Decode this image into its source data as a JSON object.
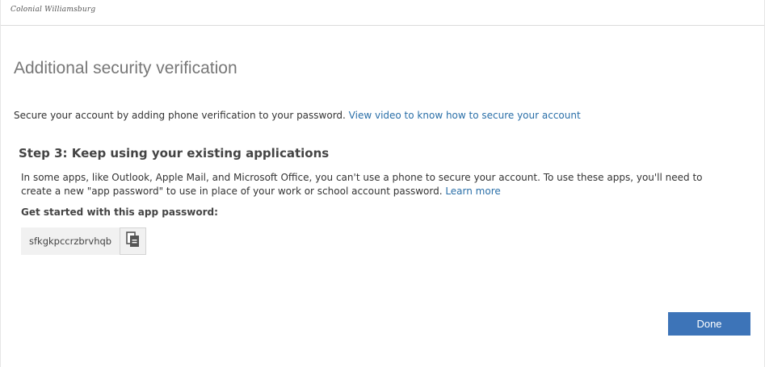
{
  "header": {
    "logo_text": "Colonial Williamsburg"
  },
  "main": {
    "title": "Additional security verification",
    "intro_text": "Secure your account by adding phone verification to your password. ",
    "intro_link": "View video to know how to secure your account",
    "step": {
      "title": "Step 3: Keep using your existing applications",
      "description": "In some apps, like Outlook, Apple Mail, and Microsoft Office, you can't use a phone to secure your account. To use these apps, you'll need to create a new \"app password\" to use in place of your work or school account password. ",
      "learn_more": "Learn more",
      "get_started_label": "Get started with this app password:",
      "app_password": "sfkgkpccrzbrvhqb",
      "copy_icon": "copy-icon"
    },
    "done_label": "Done"
  },
  "colors": {
    "accent": "#3d74b8",
    "link": "#2a6fa8",
    "title": "#777777"
  }
}
